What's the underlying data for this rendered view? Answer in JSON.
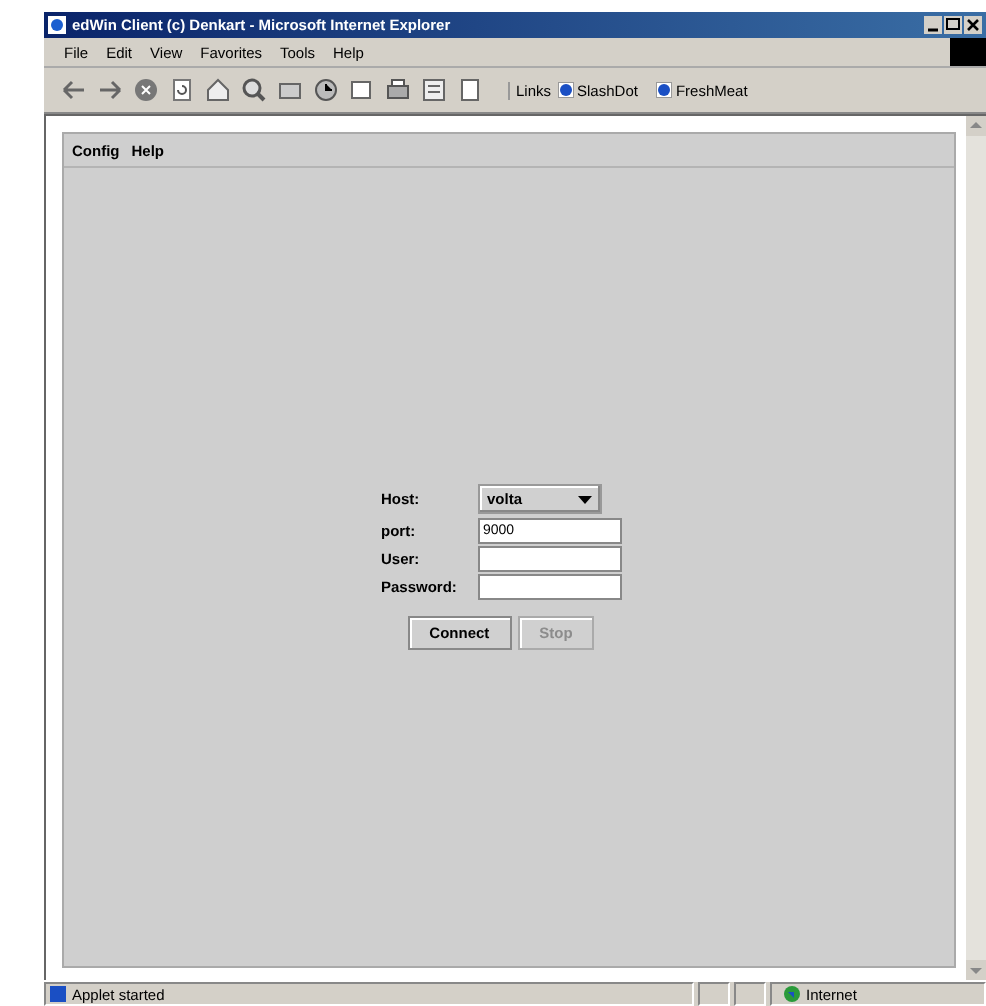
{
  "window": {
    "title": "edWin Client (c) Denkart - Microsoft Internet Explorer"
  },
  "menu": [
    "File",
    "Edit",
    "View",
    "Favorites",
    "Tools",
    "Help"
  ],
  "links": {
    "label": "Links",
    "items": [
      "SlashDot",
      "FreshMeat"
    ]
  },
  "applet": {
    "menu": [
      "Config",
      "Help"
    ],
    "fields": [
      {
        "kind": "select",
        "label": "Host:",
        "value": "volta"
      },
      {
        "kind": "text",
        "label": "port:",
        "value": "9000"
      },
      {
        "kind": "text",
        "label": "User:"
      },
      {
        "kind": "text",
        "label": "Password:"
      }
    ],
    "buttons": [
      {
        "label": "Connect",
        "disabled": false
      },
      {
        "label": "Stop",
        "disabled": true
      }
    ]
  },
  "status_bar": {
    "message": "Applet started",
    "zone": "Internet"
  }
}
